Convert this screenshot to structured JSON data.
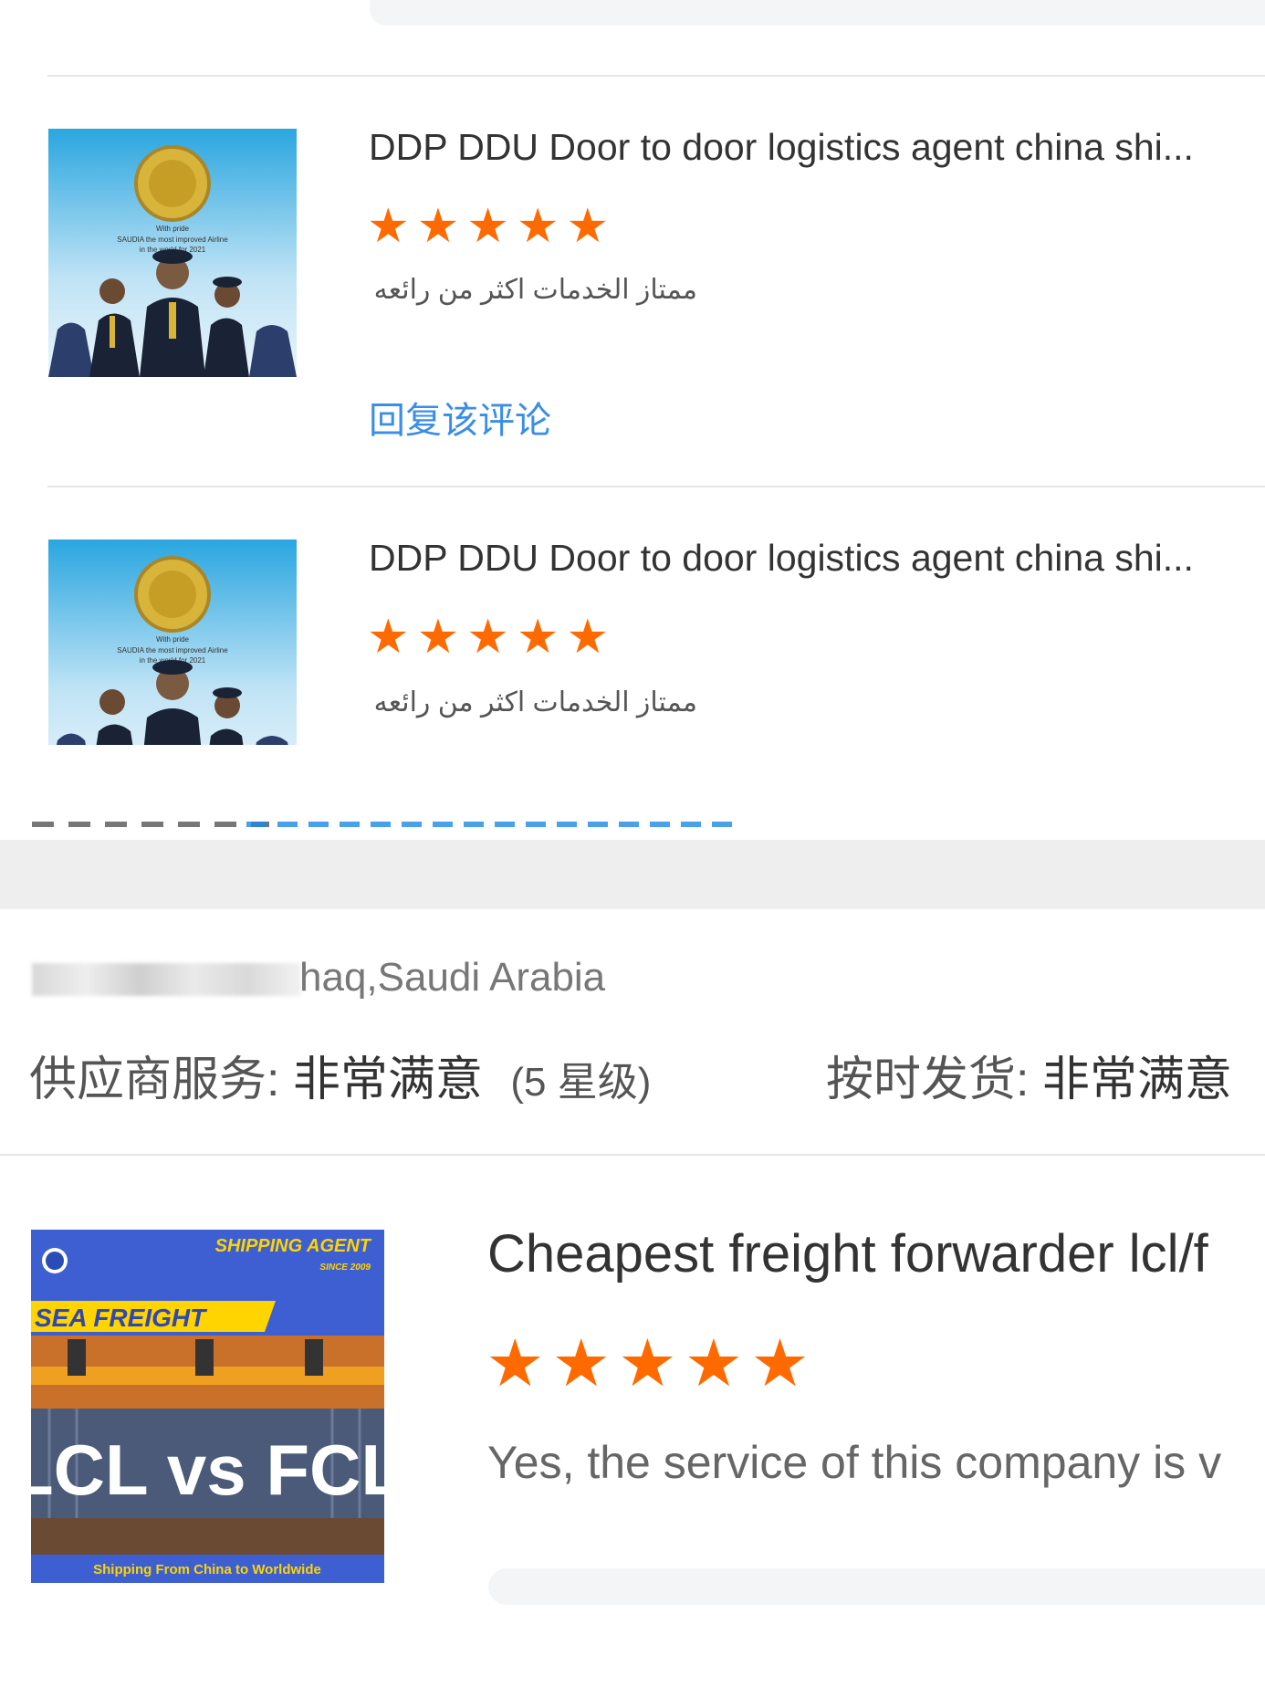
{
  "reviews": [
    {
      "title": "DDP DDU Door to door logistics agent china shi...",
      "rating": 5,
      "comment": "ممتاز الخدمات اكثر من رائعه",
      "reply_label": "回复该评论",
      "thumb_text": [
        "With pride",
        "SAUDIA the most improved Airline",
        "in the world for 2021"
      ]
    },
    {
      "title": "DDP DDU Door to door logistics agent china shi...",
      "rating": 5,
      "comment": "ممتاز الخدمات اكثر من رائعه",
      "thumb_text": [
        "With pride",
        "SAUDIA the most improved Airline",
        "in the world for 2021"
      ]
    }
  ],
  "order_block": {
    "location": "haq,Saudi Arabia",
    "supplier_service_label": "供应商服务:",
    "supplier_service_value": "非常满意",
    "supplier_service_stars": "(5 星级)",
    "ontime_label": "按时发货:",
    "ontime_value": "非常满意"
  },
  "review3": {
    "title": "Cheapest freight forwarder lcl/f",
    "rating": 5,
    "comment": "Yes, the service of this company is v",
    "thumb": {
      "banner": "SHIPPING AGENT",
      "since": "SINCE 2009",
      "tag": "SEA FREIGHT",
      "big": "LCL vs FCL",
      "footer": "Shipping From China to Worldwide"
    }
  },
  "colors": {
    "star": "#ff6a00",
    "link": "#3a8ee6"
  }
}
